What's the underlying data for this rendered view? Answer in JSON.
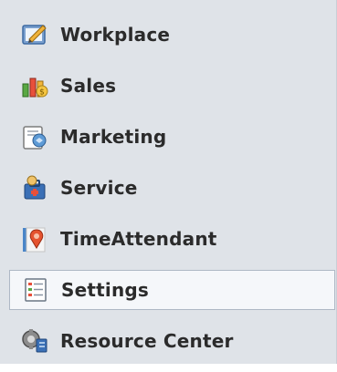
{
  "nav": {
    "items": [
      {
        "label": "Workplace",
        "icon": "workplace-icon",
        "selected": false
      },
      {
        "label": "Sales",
        "icon": "sales-icon",
        "selected": false
      },
      {
        "label": "Marketing",
        "icon": "marketing-icon",
        "selected": false
      },
      {
        "label": "Service",
        "icon": "service-icon",
        "selected": false
      },
      {
        "label": "TimeAttendant",
        "icon": "timeattendant-icon",
        "selected": false
      },
      {
        "label": "Settings",
        "icon": "settings-icon",
        "selected": true
      },
      {
        "label": "Resource Center",
        "icon": "resource-center-icon",
        "selected": false
      }
    ]
  },
  "colors": {
    "panel_background": "#dfe3e8",
    "selected_background": "#f5f7fa",
    "selected_border": "#aeb8c5",
    "label_text": "#2b2b2b"
  }
}
